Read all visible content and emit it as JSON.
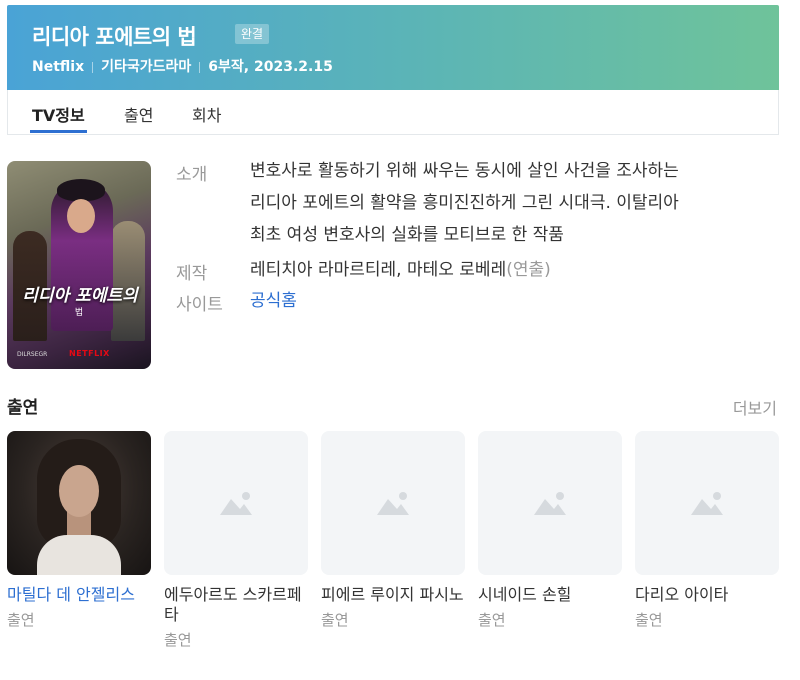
{
  "header": {
    "title": "리디아 포에트의 법",
    "badge": "완결",
    "meta": [
      "Netflix",
      "기타국가드라마",
      "6부작, 2023.2.15"
    ]
  },
  "tabs": [
    {
      "label": "TV정보",
      "active": true
    },
    {
      "label": "출연",
      "active": false
    },
    {
      "label": "회차",
      "active": false
    }
  ],
  "poster": {
    "title": "리디아 포에트의",
    "subtitle": "법",
    "brand": "NETFLIX",
    "small": "DILRSEGR"
  },
  "info": {
    "intro_label": "소개",
    "intro_lines": [
      "변호사로 활동하기 위해 싸우는 동시에 살인 사건을 조사하는",
      "리디아 포에트의 활약을 흥미진진하게 그린 시대극. 이탈리아",
      "최초 여성 변호사의 실화를 모티브로 한 작품"
    ],
    "production_label": "제작",
    "production_value": "레티치아 라마르티레, 마테오 로베레",
    "production_note": "(연출)",
    "site_label": "사이트",
    "site_value": "공식홈"
  },
  "cast_section": {
    "title": "출연",
    "more": "더보기",
    "cards": [
      {
        "name": "마틸다 데 안젤리스",
        "role": "출연",
        "has_photo": true
      },
      {
        "name": "에두아르도 스카르페타",
        "role": "출연",
        "has_photo": false
      },
      {
        "name": "피에르 루이지 파시노",
        "role": "출연",
        "has_photo": false
      },
      {
        "name": "시네이드 손힐",
        "role": "출연",
        "has_photo": false
      },
      {
        "name": "다리오 아이타",
        "role": "출연",
        "has_photo": false
      }
    ]
  },
  "colors": {
    "accent": "#2d6fd1",
    "header_start": "#4aa3d6",
    "header_end": "#6fc39a",
    "muted": "#999999",
    "placeholder_bg": "#f3f5f7"
  }
}
